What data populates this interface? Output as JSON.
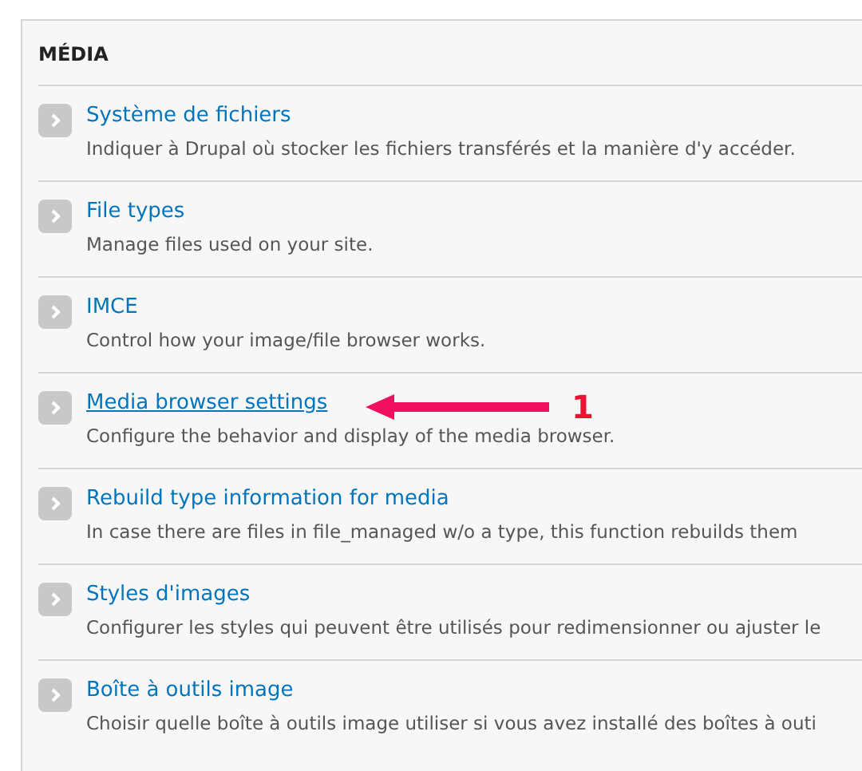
{
  "section": {
    "title": "MÉDIA"
  },
  "items": [
    {
      "title": "Système de fichiers",
      "description": "Indiquer à Drupal où stocker les fichiers transférés et la manière d'y accéder.",
      "hovered": false
    },
    {
      "title": "File types",
      "description": "Manage files used on your site.",
      "hovered": false
    },
    {
      "title": "IMCE",
      "description": "Control how your image/file browser works.",
      "hovered": false
    },
    {
      "title": "Media browser settings",
      "description": "Configure the behavior and display of the media browser.",
      "hovered": true,
      "annotation": "1"
    },
    {
      "title": "Rebuild type information for media",
      "description": "In case there are files in file_managed w/o a type, this function rebuilds them",
      "hovered": false
    },
    {
      "title": "Styles d'images",
      "description": "Configurer les styles qui peuvent être utilisés pour redimensionner ou ajuster le",
      "hovered": false
    },
    {
      "title": "Boîte à outils image",
      "description": "Choisir quelle boîte à outils image utiliser si vous avez installé des boîtes à outi",
      "hovered": false
    }
  ]
}
